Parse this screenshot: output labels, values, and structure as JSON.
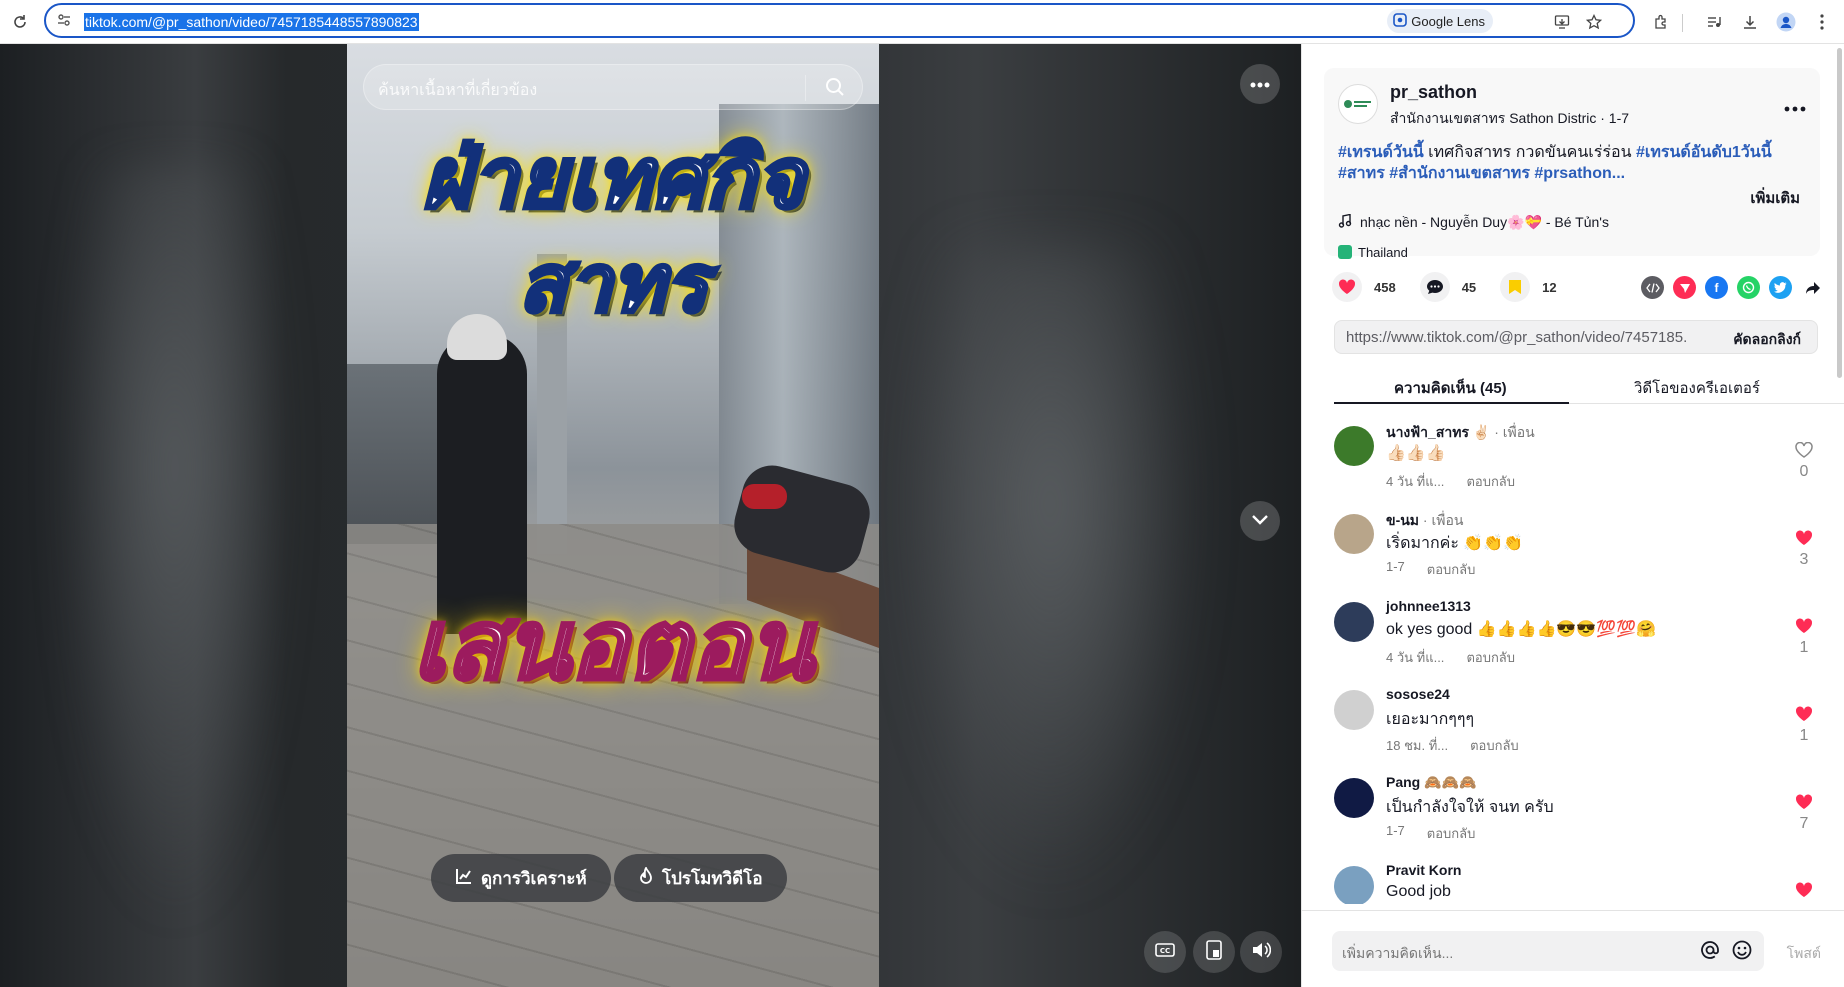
{
  "browser": {
    "url": "tiktok.com/@pr_sathon/video/7457185448557890823",
    "lens_label": "Google Lens"
  },
  "video": {
    "search_placeholder": "ค้นหาเนื้อหาที่เกี่ยวข้อง",
    "overlay_line1": "ฝ่ายเทศกิจ",
    "overlay_line2": "สาทร",
    "overlay_line3": "เสนอตอน",
    "analytics_label": "ดูการวิเคราะห์",
    "promote_label": "โปรโมทวิดีโอ"
  },
  "author": {
    "username": "pr_sathon",
    "subtitle": "สำนักงานเขตสาทร Sathon Distric · 1-7"
  },
  "description": {
    "tag1": "#เทรนด์วันนี้",
    "text1": " เทศกิจสาทร กวดขันคนเร่ร่อน ",
    "tag2": "#เทรนด์อันดับ1วันนี้",
    "tag3": "#สาทร",
    "tag4": "#สำนักงานเขตสาทร",
    "tag5": "#prsathon...",
    "see_more": "เพิ่มเติม"
  },
  "music": "nhạc nền - Nguyễn Duy🌸💝 - Bé Tủn's",
  "location": "Thailand",
  "stats": {
    "likes": "458",
    "comments": "45",
    "saves": "12"
  },
  "link": {
    "url": "https://www.tiktok.com/@pr_sathon/video/7457185...",
    "copy_label": "คัดลอกลิงก์"
  },
  "tabs": {
    "comments": "ความคิดเห็น (45)",
    "creator": "วิดีโอของครีเอเตอร์"
  },
  "comments": [
    {
      "user": "นางฟ้า_สาทร ✌🏻",
      "friend": " · เพื่อน",
      "text": "👍🏻👍🏻👍🏻",
      "time": "4 วัน ที่แ...",
      "reply": "ตอบกลับ",
      "likes": "0",
      "liked": false,
      "avatar_color": "#3c7a2a"
    },
    {
      "user": "ข-นม",
      "friend": " · เพื่อน",
      "text": "เริ่ดมากค่ะ 👏👏👏",
      "time": "1-7",
      "reply": "ตอบกลับ",
      "likes": "3",
      "liked": true,
      "avatar_color": "#b8a58a"
    },
    {
      "user": "johnnee1313",
      "friend": "",
      "text": "ok yes good 👍👍👍👍😎😎💯💯🤗",
      "time": "4 วัน ที่แ...",
      "reply": "ตอบกลับ",
      "likes": "1",
      "liked": true,
      "avatar_color": "#2d3c5a"
    },
    {
      "user": "sosose24",
      "friend": "",
      "text": "เยอะมากๆๆๆ",
      "time": "18 ชม. ที่...",
      "reply": "ตอบกลับ",
      "likes": "1",
      "liked": true,
      "avatar_color": "#d0d0d0"
    },
    {
      "user": "Pang 🙈🙈🙈",
      "friend": "",
      "text": "เป็นกำลังใจให้ จนท ครับ",
      "time": "1-7",
      "reply": "ตอบกลับ",
      "likes": "7",
      "liked": true,
      "avatar_color": "#101a44"
    },
    {
      "user": "Pravit Korn",
      "friend": "",
      "text": "Good job",
      "time": "",
      "reply": "",
      "likes": "",
      "liked": true,
      "avatar_color": "#7aa0c0"
    }
  ],
  "comment_input": {
    "placeholder": "เพิ่มความคิดเห็น...",
    "post_label": "โพสต์"
  },
  "colors": {
    "accent_link": "#2b5db9",
    "heart": "#fe2c55"
  }
}
